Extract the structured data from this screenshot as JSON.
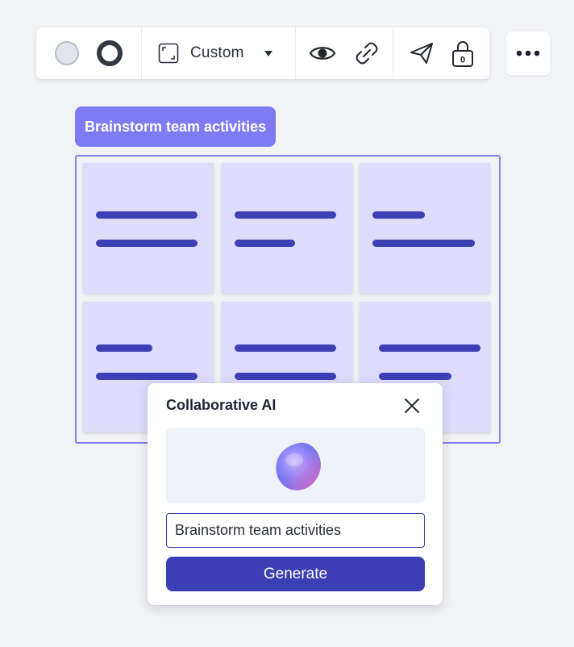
{
  "toolbar": {
    "fill_color": "#e2e4ea",
    "stroke_color": "#343843",
    "size_icon": "resize-frame-icon",
    "size_label": "Custom",
    "dropdown_icon": "caret-down-icon",
    "view_icon": "eye-icon",
    "link_icon": "link-icon",
    "share_icon": "paper-plane-icon",
    "lock_icon": "lock-icon",
    "lock_badge": "0"
  },
  "more_menu": {
    "icon": "more-horizontal-icon"
  },
  "frame": {
    "title": "Brainstorm team activities",
    "title_color": "#7f7cf3",
    "border_color": "#8481f0",
    "note_color": "#dddcfb",
    "line_color": "#3d3fb4"
  },
  "ai_panel": {
    "title": "Collaborative AI",
    "close_icon": "close-icon",
    "preview_icon": "ai-orb-icon",
    "input_value": "Brainstorm team activities",
    "generate_label": "Generate",
    "accent": "#3b3fb3"
  }
}
